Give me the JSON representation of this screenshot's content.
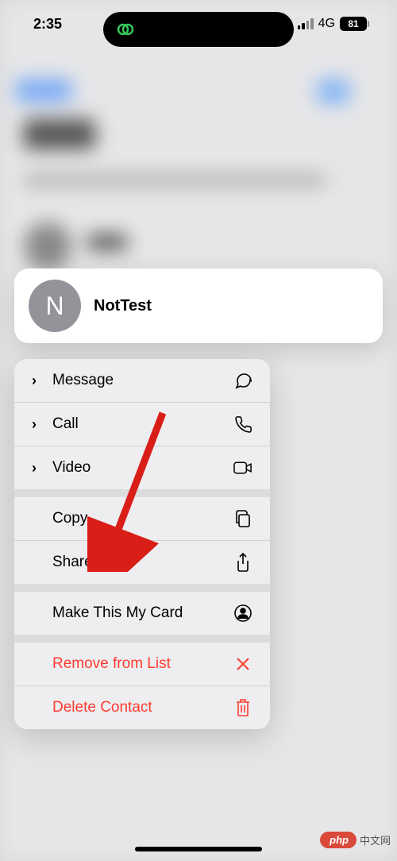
{
  "status": {
    "time": "2:35",
    "network": "4G",
    "battery": "81"
  },
  "contact": {
    "initial": "N",
    "name": "NotTest"
  },
  "menu": {
    "message": "Message",
    "call": "Call",
    "video": "Video",
    "copy": "Copy",
    "share": "Share",
    "make_card": "Make This My Card",
    "remove": "Remove from List",
    "delete": "Delete Contact"
  },
  "watermark": {
    "badge": "php",
    "text": "中文网"
  }
}
